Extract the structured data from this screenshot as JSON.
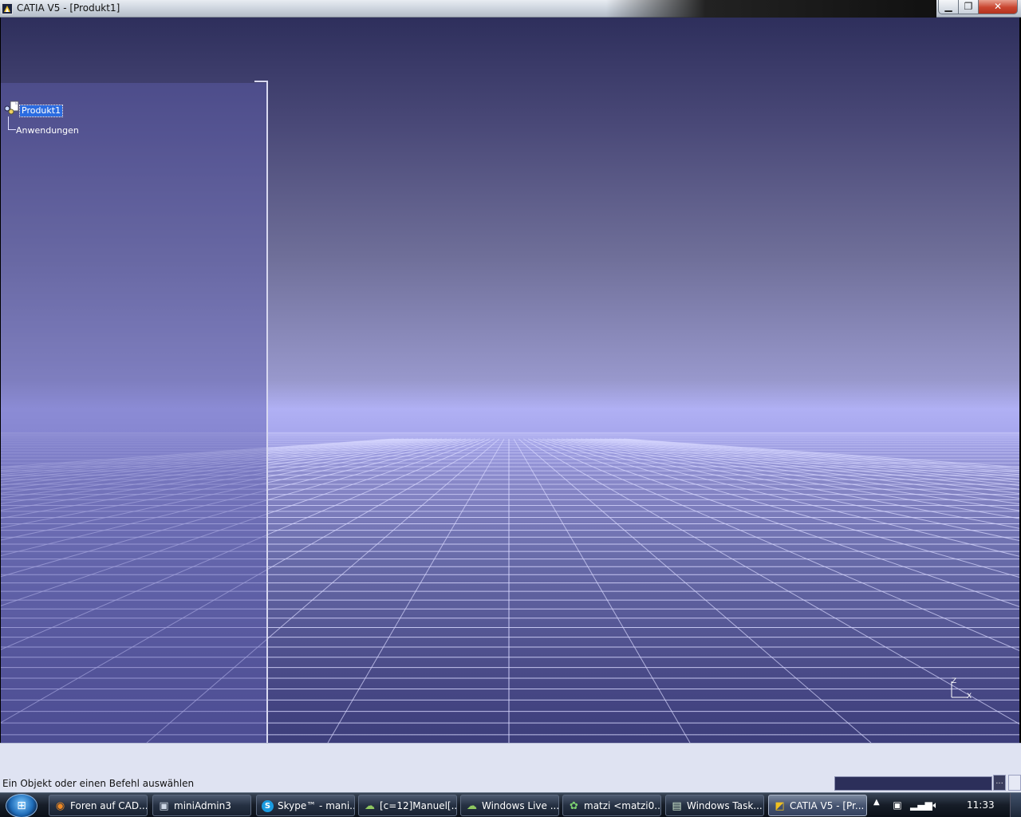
{
  "window": {
    "title": "CATIA V5 - [Produkt1]",
    "minimize_glyph": "▁",
    "maximize_glyph": "❐",
    "close_glyph": "✕"
  },
  "tree": {
    "root_label": "Produkt1",
    "child_label": "Anwendungen"
  },
  "viewport": {
    "axis_z_label": "Z",
    "axis_x_label": "X"
  },
  "status": {
    "message": "Ein Objekt oder einen Befehl auswählen",
    "command_button": "..."
  },
  "taskbar": {
    "items": [
      {
        "label": "Foren auf CAD....",
        "icon": "firefox-icon",
        "glyph": "◉"
      },
      {
        "label": "miniAdmin3",
        "icon": "network-icon",
        "glyph": "▣"
      },
      {
        "label": "Skype™ - mani...",
        "icon": "skype-icon",
        "glyph": "S"
      },
      {
        "label": "[c=12]Manuel[...",
        "icon": "messenger-icon",
        "glyph": "☁"
      },
      {
        "label": "Windows Live ...",
        "icon": "windows-live-icon",
        "glyph": "☁"
      },
      {
        "label": "matzi <matzi0...",
        "icon": "chat-icon",
        "glyph": "✿"
      },
      {
        "label": "Windows Task...",
        "icon": "task-manager-icon",
        "glyph": "▤"
      },
      {
        "label": "CATIA V5 - [Pr...",
        "icon": "catia-icon",
        "glyph": "◩"
      }
    ],
    "tray_arrow": "▲",
    "clock": "11:33"
  },
  "colors": {
    "background_top": "#2e2f5c",
    "horizon": "#b0b0f4",
    "grid_line": "#d8d8ff",
    "tree_selection": "#2b6ce0"
  }
}
